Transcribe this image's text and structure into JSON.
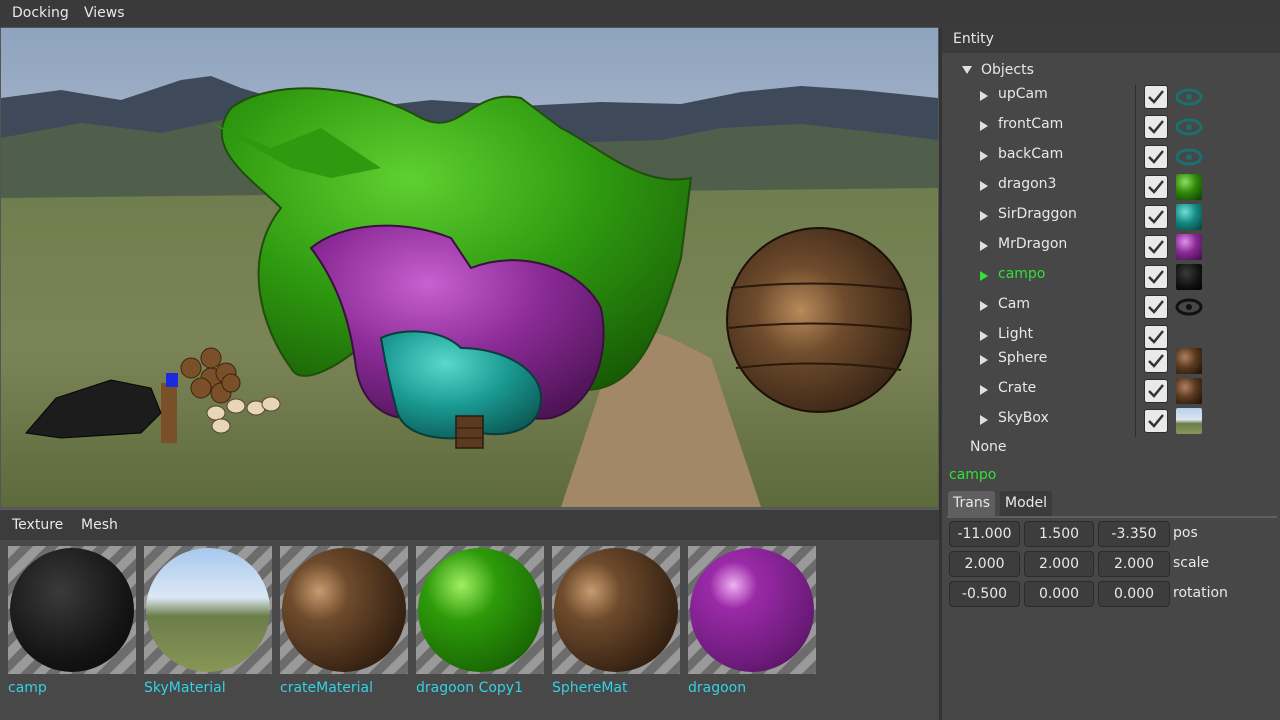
{
  "menubar": {
    "items": [
      "Docking",
      "Views"
    ]
  },
  "bottom_panel": {
    "tabs": [
      "Texture",
      "Mesh"
    ],
    "materials": [
      {
        "label": "camp"
      },
      {
        "label": "SkyMaterial"
      },
      {
        "label": "crateMaterial"
      },
      {
        "label": "dragoon Copy1"
      },
      {
        "label": "SphereMat"
      },
      {
        "label": "dragoon"
      }
    ]
  },
  "entity_panel": {
    "title": "Entity",
    "root": "Objects",
    "objects": [
      {
        "name": "upCam",
        "icon": "eye-icon"
      },
      {
        "name": "frontCam",
        "icon": "eye-icon"
      },
      {
        "name": "backCam",
        "icon": "eye-icon"
      },
      {
        "name": "dragon3",
        "icon": "green-material-swatch"
      },
      {
        "name": "SirDraggon",
        "icon": "teal-material-swatch"
      },
      {
        "name": "MrDragon",
        "icon": "purple-material-swatch"
      },
      {
        "name": "campo",
        "icon": "black-stone-material-swatch"
      },
      {
        "name": "Cam",
        "icon": "eye-icon"
      },
      {
        "name": "Light",
        "icon": ""
      },
      {
        "name": "Sphere",
        "icon": "wood-material-swatch"
      },
      {
        "name": "Crate",
        "icon": "wood-material-swatch"
      },
      {
        "name": "SkyBox",
        "icon": "sky-material-swatch"
      }
    ],
    "selected": "campo",
    "none_label": "None",
    "selected_name": "campo",
    "tabs": [
      "Trans",
      "Model"
    ],
    "active_tab": "Trans",
    "transform": {
      "pos": {
        "label": "pos",
        "values": [
          "-11.000",
          "1.500",
          "-3.350"
        ]
      },
      "scale": {
        "label": "scale",
        "values": [
          "2.000",
          "2.000",
          "2.000"
        ]
      },
      "rotation": {
        "label": "rotation",
        "values": [
          "-0.500",
          "0.000",
          "0.000"
        ]
      }
    }
  },
  "colors": {
    "selection": "#33e033",
    "material_label": "#33d1e6",
    "camera_eye": "#1b6f6f"
  }
}
